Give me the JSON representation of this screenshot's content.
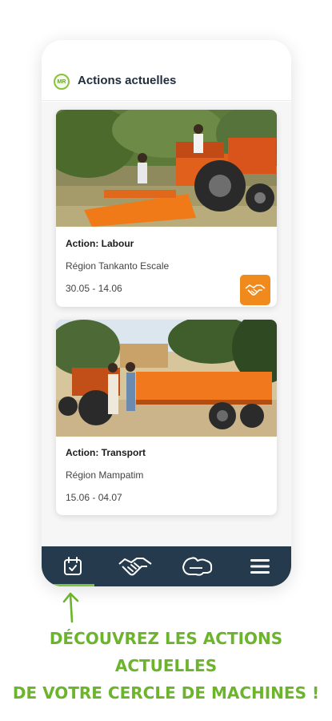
{
  "header": {
    "logo_text": "MR",
    "title": "Actions actuelles"
  },
  "cards": [
    {
      "action": "Action: Labour",
      "region": "Région Tankanto Escale",
      "dates": "30.05 - 14.06",
      "badge_icon": "handshake-icon",
      "image": "tractor with orange tiller in field"
    },
    {
      "action": "Action: Transport",
      "region": "Région Mampatim",
      "dates": "15.06 - 04.07",
      "image": "tractor with orange trailer"
    }
  ],
  "navbar": {
    "items": [
      "calendar-icon",
      "handshake-icon",
      "map-icon",
      "menu-icon"
    ],
    "active": "calendar-icon"
  },
  "tagline": {
    "line1": "DÉCOUVREZ LES ACTIONS ACTUELLES",
    "line2": "DE VOTRE CERCLE DE MACHINES !"
  },
  "colors": {
    "accent_green": "#6cb42c",
    "nav_bg": "#253a4c",
    "badge_orange": "#f08a1c"
  }
}
